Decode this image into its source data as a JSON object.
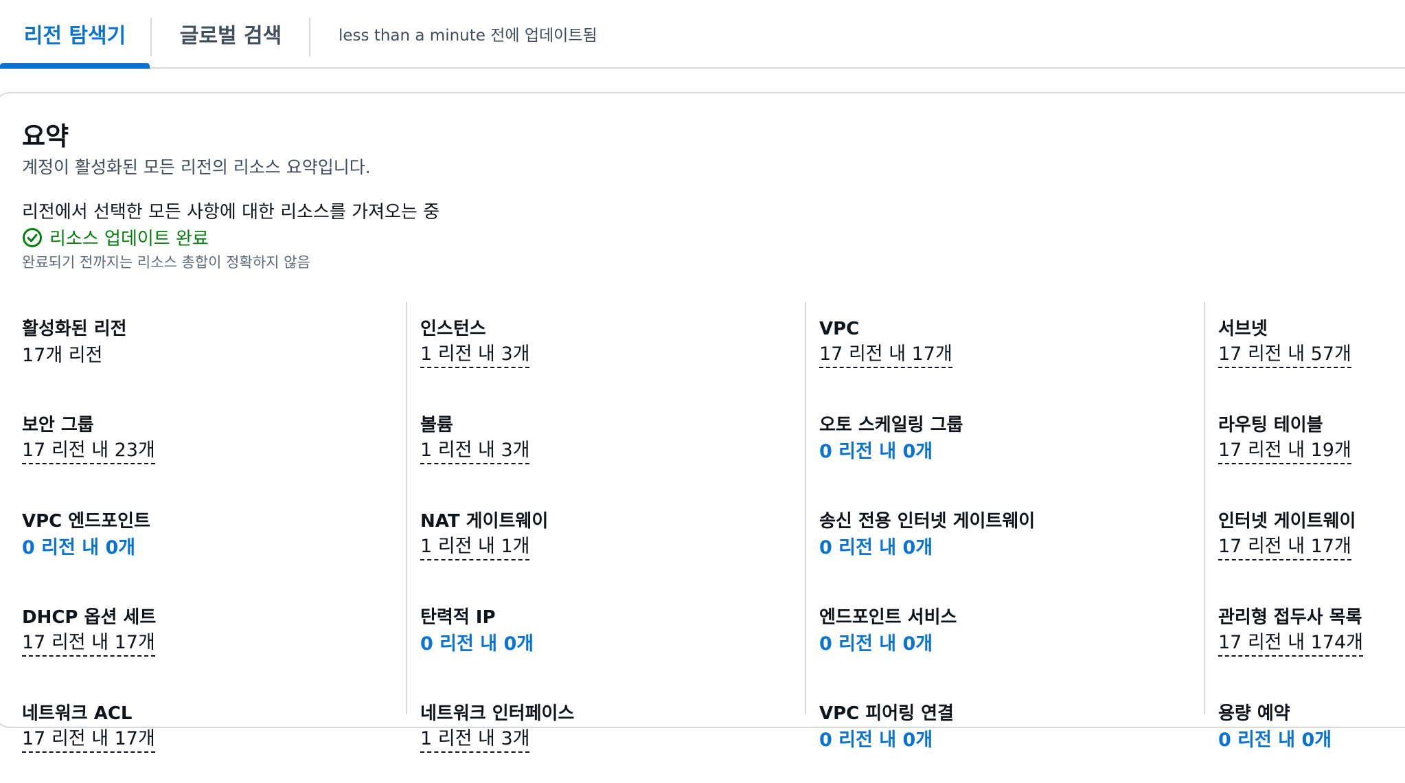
{
  "tabs": [
    {
      "label": "리전 탐색기",
      "active": true
    },
    {
      "label": "글로벌 검색",
      "active": false
    }
  ],
  "updated_text": "less than a minute 전에 업데이트됨",
  "summary": {
    "title": "요약",
    "description": "계정이 활성화된 모든 리전의 리소스 요약입니다.",
    "loading_text": "리전에서 선택한 모든 사항에 대한 리소스를 가져오는 중",
    "status_text": "리소스 업데이트 완료",
    "note": "완료되기 전까지는 리소스 총합이 정확하지 않음"
  },
  "columns": [
    [
      {
        "label": "활성화된 리전",
        "value": "17개 리전",
        "style": "plain"
      },
      {
        "label": "보안 그룹",
        "value": "17 리전 내 23개",
        "style": "dashed"
      },
      {
        "label": "VPC 엔드포인트",
        "value": "0 리전 내 0개",
        "style": "link"
      },
      {
        "label": "DHCP 옵션 세트",
        "value": "17 리전 내 17개",
        "style": "dashed"
      },
      {
        "label": "네트워크 ACL",
        "value": "17 리전 내 17개",
        "style": "dashed"
      }
    ],
    [
      {
        "label": "인스턴스",
        "value": "1 리전 내 3개",
        "style": "dashed"
      },
      {
        "label": "볼륨",
        "value": "1 리전 내 3개",
        "style": "dashed"
      },
      {
        "label": "NAT 게이트웨이",
        "value": "1 리전 내 1개",
        "style": "dashed"
      },
      {
        "label": "탄력적 IP",
        "value": "0 리전 내 0개",
        "style": "link"
      },
      {
        "label": "네트워크 인터페이스",
        "value": "1 리전 내 3개",
        "style": "dashed"
      }
    ],
    [
      {
        "label": "VPC",
        "value": "17 리전 내 17개",
        "style": "dashed"
      },
      {
        "label": "오토 스케일링 그룹",
        "value": "0 리전 내 0개",
        "style": "link"
      },
      {
        "label": "송신 전용 인터넷 게이트웨이",
        "value": "0 리전 내 0개",
        "style": "link"
      },
      {
        "label": "엔드포인트 서비스",
        "value": "0 리전 내 0개",
        "style": "link"
      },
      {
        "label": "VPC 피어링 연결",
        "value": "0 리전 내 0개",
        "style": "link"
      }
    ],
    [
      {
        "label": "서브넷",
        "value": "17 리전 내 57개",
        "style": "dashed"
      },
      {
        "label": "라우팅 테이블",
        "value": "17 리전 내 19개",
        "style": "dashed"
      },
      {
        "label": "인터넷 게이트웨이",
        "value": "17 리전 내 17개",
        "style": "dashed"
      },
      {
        "label": "관리형 접두사 목록",
        "value": "17 리전 내 174개",
        "style": "dashed"
      },
      {
        "label": "용량 예약",
        "value": "0 리전 내 0개",
        "style": "link"
      }
    ]
  ],
  "colors": {
    "accent": "#0972d3",
    "success": "#037f0c",
    "border": "#d5dbdb"
  }
}
